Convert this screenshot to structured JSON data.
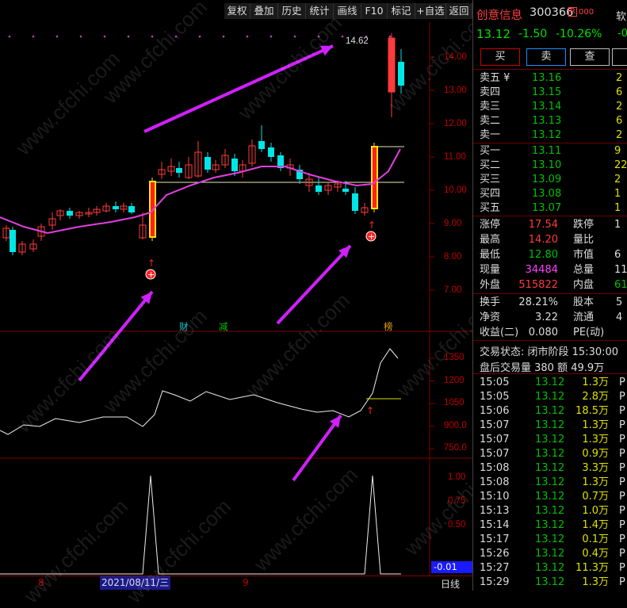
{
  "toolbar": {
    "buttons": [
      "复权",
      "叠加",
      "历史",
      "统计",
      "画线",
      "F10",
      "标记",
      "+自选",
      "返回"
    ]
  },
  "chart": {
    "price_ticks": [
      "14.00",
      "13.00",
      "12.00",
      "11.00",
      "10.00",
      "9.00",
      "8.00",
      "7.00"
    ],
    "high_label": "14.62",
    "mid_ticks": [
      "1350",
      "1200",
      "1050",
      "900.0",
      "750.0"
    ],
    "low_ticks": [
      "1.00",
      "0.75",
      "0.50"
    ],
    "low_current": "-0.01",
    "markers": {
      "cai": "财",
      "jian": "减",
      "bang": "榜"
    },
    "date_labels": {
      "left": "8",
      "selected": "2021/08/11/三",
      "right": "9"
    },
    "period": "日线",
    "watermark": "www.cfchi.com"
  },
  "stock": {
    "name": "创意信息",
    "code": "300366",
    "badge": "R",
    "price": "13.12",
    "change": "-1.50",
    "change_pct": "-10.26%",
    "right_clip_top": "软",
    "right_clip_pct": "-0"
  },
  "actions": {
    "buy": "买",
    "sell": "卖",
    "check": "查"
  },
  "asks": [
    {
      "label": "卖五 ¥",
      "price": "13.16",
      "vol": "2"
    },
    {
      "label": "卖四",
      "price": "13.15",
      "vol": "6"
    },
    {
      "label": "卖三",
      "price": "13.14",
      "vol": "2"
    },
    {
      "label": "卖二",
      "price": "13.13",
      "vol": "6"
    },
    {
      "label": "卖一",
      "price": "13.12",
      "vol": "2"
    }
  ],
  "bids": [
    {
      "label": "买一",
      "price": "13.11",
      "vol": "9"
    },
    {
      "label": "买二",
      "price": "13.10",
      "vol": "22"
    },
    {
      "label": "买三",
      "price": "13.09",
      "vol": "2"
    },
    {
      "label": "买四",
      "price": "13.08",
      "vol": "1"
    },
    {
      "label": "买五",
      "price": "13.07",
      "vol": "1"
    }
  ],
  "stats": [
    {
      "l1": "涨停",
      "v1": "17.54",
      "l2": "跌停",
      "v2": "1"
    },
    {
      "l1": "最高",
      "v1": "14.20",
      "l2": "量比",
      "v2": ""
    },
    {
      "l1": "最低",
      "v1": "12.80",
      "l2": "市值",
      "v2": "6"
    },
    {
      "l1": "现量",
      "v1": "34484",
      "l2": "总量",
      "v2": "11"
    },
    {
      "l1": "外盘",
      "v1": "515822",
      "l2": "内盘",
      "v2": "61"
    }
  ],
  "fundamentals": [
    {
      "l1": "换手",
      "v1": "28.21%",
      "l2": "股本",
      "v2": "5"
    },
    {
      "l1": "净资",
      "v1": "3.22",
      "l2": "流通",
      "v2": "4"
    },
    {
      "l1": "收益(二)",
      "v1": "0.080",
      "l2": "PE(动)",
      "v2": ""
    }
  ],
  "trade_status": "交易状态: 闭市阶段 15:30:00",
  "after_hours": "盘后交易量 380 额 49.9万",
  "ticks": [
    {
      "t": "15:05",
      "p": "13.12",
      "v": "1.3万",
      "d": "P"
    },
    {
      "t": "15:05",
      "p": "13.12",
      "v": "2.8万",
      "d": "P"
    },
    {
      "t": "15:06",
      "p": "13.12",
      "v": "18.5万",
      "d": "P"
    },
    {
      "t": "15:07",
      "p": "13.12",
      "v": "1.3万",
      "d": "P"
    },
    {
      "t": "15:07",
      "p": "13.12",
      "v": "1.3万",
      "d": "P"
    },
    {
      "t": "15:07",
      "p": "13.12",
      "v": "0.9万",
      "d": "P"
    },
    {
      "t": "15:08",
      "p": "13.12",
      "v": "3.3万",
      "d": "P"
    },
    {
      "t": "15:08",
      "p": "13.12",
      "v": "1.3万",
      "d": "P"
    },
    {
      "t": "15:10",
      "p": "13.12",
      "v": "0.7万",
      "d": "P"
    },
    {
      "t": "15:13",
      "p": "13.12",
      "v": "1.0万",
      "d": "P"
    },
    {
      "t": "15:14",
      "p": "13.12",
      "v": "1.4万",
      "d": "P"
    },
    {
      "t": "15:17",
      "p": "13.12",
      "v": "0.1万",
      "d": "P"
    },
    {
      "t": "15:26",
      "p": "13.12",
      "v": "0.4万",
      "d": "P"
    },
    {
      "t": "15:27",
      "p": "13.12",
      "v": "11.3万",
      "d": "P"
    },
    {
      "t": "15:29",
      "p": "13.12",
      "v": "1.3万",
      "d": "P"
    }
  ],
  "colors": {
    "up": "#ff3b3b",
    "down": "#00e5e5",
    "ma": "#e040e0",
    "arrow": "#d020ff",
    "bg": "#000000"
  }
}
